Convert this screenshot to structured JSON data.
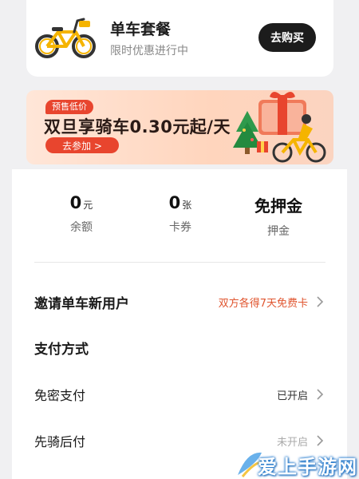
{
  "bike_pass_card": {
    "title": "单车套餐",
    "subtitle": "限时优惠进行中",
    "button": "去购买",
    "icon": "bicycle"
  },
  "promo": {
    "tag": "预售低价",
    "title": "双旦享骑车0.30元起/天",
    "button": "去参加 >",
    "accent": "#e8452e"
  },
  "stats": [
    {
      "value": "0",
      "unit": "元",
      "label": "余额"
    },
    {
      "value": "0",
      "unit": "张",
      "label": "卡券"
    },
    {
      "value": "免押金",
      "unit": "",
      "label": "押金"
    }
  ],
  "rows": {
    "invite": {
      "label": "邀请单车新用户",
      "value": "双方各得7天免费卡"
    },
    "payment_title": "支付方式",
    "password_free": {
      "label": "免密支付",
      "value": "已开启"
    },
    "ride_first": {
      "label": "先骑后付",
      "value": "未开启"
    }
  },
  "watermark": "爱上手游网"
}
